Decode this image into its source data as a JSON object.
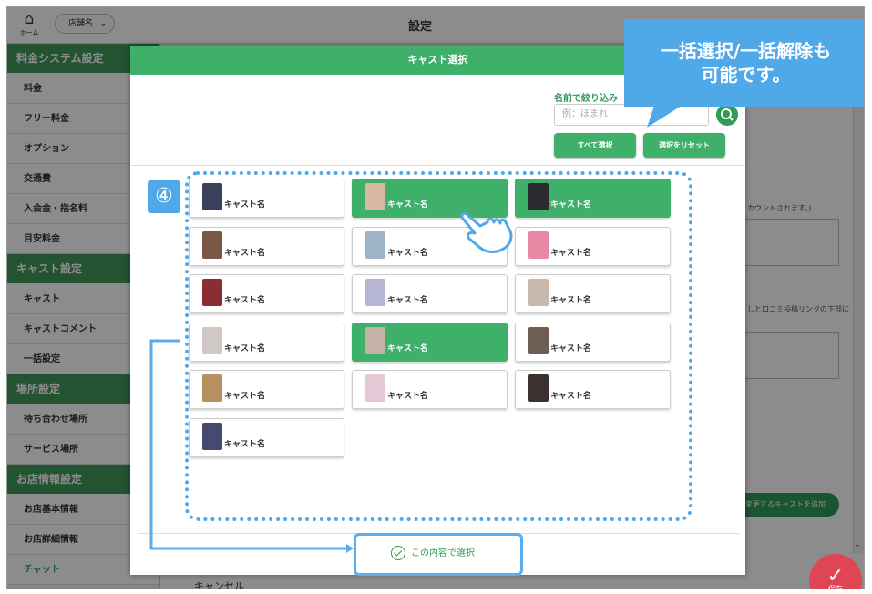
{
  "topbar": {
    "home_label": "ホーム",
    "store_select": "店舗名",
    "title": "設定"
  },
  "sidebar": {
    "sections": [
      {
        "heading": "料金システム設定",
        "items": [
          "料金",
          "フリー料金",
          "オプション",
          "交通費",
          "入会金・指名料",
          "目安料金"
        ]
      },
      {
        "heading": "キャスト設定",
        "items": [
          "キャスト",
          "キャストコメント",
          "一括設定"
        ]
      },
      {
        "heading": "場所設定",
        "items": [
          "待ち合わせ場所",
          "サービス場所"
        ]
      },
      {
        "heading": "お店情報設定",
        "items": [
          "お店基本情報",
          "お店詳細情報",
          "チャット"
        ]
      }
    ]
  },
  "background": {
    "text1": "カウントされます。)",
    "text2": "しと口コミ投稿リンクの下部に",
    "add_cast_button": "変更するキャストを追加",
    "cancel": "キャンセル",
    "save": "保存"
  },
  "modal": {
    "title": "キャスト選択",
    "filter_label": "名前で絞り込み",
    "filter_placeholder": "例：ほまれ",
    "select_all": "すべて選択",
    "reset": "選択をリセット",
    "confirm": "この内容で選択",
    "casts": [
      {
        "name": "キャスト名",
        "selected": false,
        "photo_color": "#3a3f5a"
      },
      {
        "name": "キャスト名",
        "selected": true,
        "photo_color": "#d9b8a3"
      },
      {
        "name": "キャスト名",
        "selected": true,
        "photo_color": "#2c2c30"
      },
      {
        "name": "キャスト名",
        "selected": false,
        "photo_color": "#7a5845"
      },
      {
        "name": "キャスト名",
        "selected": false,
        "photo_color": "#9fb4c9"
      },
      {
        "name": "キャスト名",
        "selected": false,
        "photo_color": "#e889a6"
      },
      {
        "name": "キャスト名",
        "selected": false,
        "photo_color": "#8a2d34"
      },
      {
        "name": "キャスト名",
        "selected": false,
        "photo_color": "#b6b6d4"
      },
      {
        "name": "キャスト名",
        "selected": false,
        "photo_color": "#c9b9ad"
      },
      {
        "name": "キャスト名",
        "selected": false,
        "photo_color": "#cfc8c4"
      },
      {
        "name": "キャスト名",
        "selected": true,
        "photo_color": "#c4b2a9"
      },
      {
        "name": "キャスト名",
        "selected": false,
        "photo_color": "#6d5d52"
      },
      {
        "name": "キャスト名",
        "selected": false,
        "photo_color": "#b88f5f"
      },
      {
        "name": "キャスト名",
        "selected": false,
        "photo_color": "#e5c9d6"
      },
      {
        "name": "キャスト名",
        "selected": false,
        "photo_color": "#3b3230"
      },
      {
        "name": "キャスト名",
        "selected": false,
        "photo_color": "#454a70"
      }
    ]
  },
  "annotation": {
    "step": "④",
    "callout_line1": "一括選択/一括解除も",
    "callout_line2": "可能です。"
  },
  "colors": {
    "green": "#3fb06a",
    "dark_green": "#2f9c55",
    "annotation_blue": "#4fa9e8"
  }
}
